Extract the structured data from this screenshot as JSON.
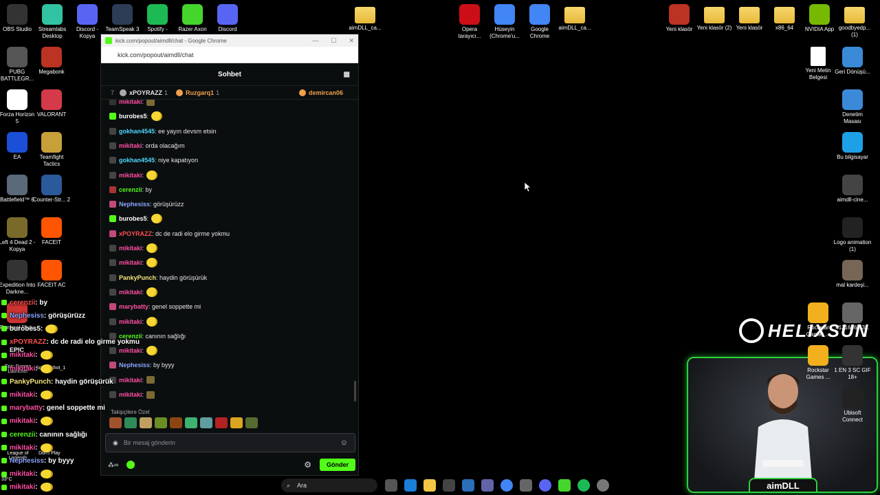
{
  "browser": {
    "title": "kick.com/popout/aimdll/chat - Google Chrome",
    "url": "kick.com/popout/aimdll/chat"
  },
  "chat": {
    "header": "Sohbet",
    "top_gifters": [
      {
        "rank": "7",
        "name": "xPOYRAZZ",
        "count": "1",
        "color": "#e3e3e3"
      },
      {
        "rank": "",
        "name": "Ruzgarq1",
        "count": "1",
        "color": "#f0a04b"
      },
      {
        "rank": "",
        "name": "demircan06",
        "count": "",
        "color": "#f0a04b"
      }
    ],
    "messages": [
      {
        "user": "mikitaki",
        "text": "",
        "color": "#ff4fa3",
        "emote": "box",
        "badge": "#333"
      },
      {
        "user": "burobes5",
        "text": "",
        "color": "#ffffff",
        "emote": "face",
        "badge": "#53fc18"
      },
      {
        "user": "gokhan4545",
        "text": ": ee yayın devsm etsin",
        "color": "#4fd8ff",
        "emote": "",
        "badge": "#444"
      },
      {
        "user": "mikitaki",
        "text": ": orda olacağım",
        "color": "#ff4fa3",
        "emote": "",
        "badge": "#444"
      },
      {
        "user": "gokhan4545",
        "text": ": niye kapatıyon",
        "color": "#4fd8ff",
        "emote": "",
        "badge": "#444"
      },
      {
        "user": "mikitaki",
        "text": "",
        "color": "#ff4fa3",
        "emote": "face",
        "badge": "#444"
      },
      {
        "user": "cerenzii",
        "text": ": by",
        "color": "#53fc18",
        "emote": "",
        "badge": "#a33"
      },
      {
        "user": "Nephesiss",
        "text": ": görüşürüzz",
        "color": "#8aa4ff",
        "emote": "",
        "badge": "#c24a7b"
      },
      {
        "user": "burobes5",
        "text": "",
        "color": "#ffffff",
        "emote": "face",
        "badge": "#53fc18"
      },
      {
        "user": "xPOYRAZZ",
        "text": ": dc de radi elo girme yokmu",
        "color": "#ff4f4f",
        "emote": "",
        "badge": "#c24a7b"
      },
      {
        "user": "mikitaki",
        "text": "",
        "color": "#ff4fa3",
        "emote": "face",
        "badge": "#444"
      },
      {
        "user": "mikitaki",
        "text": "",
        "color": "#ff4fa3",
        "emote": "face",
        "badge": "#444"
      },
      {
        "user": "PankyPunch",
        "text": ": haydin görüşürük",
        "color": "#f5e57a",
        "emote": "",
        "badge": "#444"
      },
      {
        "user": "mikitaki",
        "text": "",
        "color": "#ff4fa3",
        "emote": "face",
        "badge": "#444"
      },
      {
        "user": "marybatty",
        "text": ": genel soppette mi",
        "color": "#ff4fa3",
        "emote": "",
        "badge": "#c24a7b"
      },
      {
        "user": "mikitaki",
        "text": "",
        "color": "#ff4fa3",
        "emote": "face",
        "badge": "#444"
      },
      {
        "user": "cerenzii",
        "text": ": canının sağlığı",
        "color": "#53fc18",
        "emote": "",
        "badge": "#444"
      },
      {
        "user": "mikitaki",
        "text": "",
        "color": "#ff4fa3",
        "emote": "face",
        "badge": "#444"
      },
      {
        "user": "Nephesiss",
        "text": ": by byyy",
        "color": "#8aa4ff",
        "emote": "",
        "badge": "#c24a7b"
      },
      {
        "user": "mikitaki",
        "text": "",
        "color": "#ff4fa3",
        "emote": "box",
        "badge": "#444"
      },
      {
        "user": "mikitaki",
        "text": "",
        "color": "#ff4fa3",
        "emote": "box",
        "badge": "#444"
      }
    ],
    "followers_label": "Takipçilere Özel",
    "input_placeholder": "Bir mesaj gönderin",
    "send_label": "Gönder"
  },
  "overlay": [
    {
      "user": "cerenzii",
      "text": " : by",
      "color": "#ff4f4f",
      "emote": false
    },
    {
      "user": "Nephesiss",
      "text": " : görüşürüzz",
      "color": "#8aa4ff",
      "emote": false
    },
    {
      "user": "burobes5",
      "text": " :",
      "color": "#ffffff",
      "emote": true
    },
    {
      "user": "xPOYRAZZ",
      "text": " : dc de radi elo girme yokmu",
      "color": "#ff4f4f",
      "emote": false
    },
    {
      "user": "mikitaki",
      "text": " :",
      "color": "#ff4fa3",
      "emote": true
    },
    {
      "user": "mikitaki",
      "text": " :",
      "color": "#ff4fa3",
      "emote": true
    },
    {
      "user": "PankyPunch",
      "text": " : haydin görüşürük",
      "color": "#f5e57a",
      "emote": false
    },
    {
      "user": "mikitaki",
      "text": " :",
      "color": "#ff4fa3",
      "emote": true
    },
    {
      "user": "marybatty",
      "text": " : genel soppette mi",
      "color": "#ff4fa3",
      "emote": false
    },
    {
      "user": "mikitaki",
      "text": " :",
      "color": "#ff4fa3",
      "emote": true
    },
    {
      "user": "cerenzii",
      "text": " : canının sağlığı",
      "color": "#53fc18",
      "emote": false
    },
    {
      "user": "mikitaki",
      "text": " :",
      "color": "#ff4fa3",
      "emote": true
    },
    {
      "user": "Nephesiss",
      "text": " : by byyy",
      "color": "#8aa4ff",
      "emote": false
    },
    {
      "user": "mikitaki",
      "text": " :",
      "color": "#ff4fa3",
      "emote": true
    },
    {
      "user": "mikitaki",
      "text": " :",
      "color": "#ff4fa3",
      "emote": true
    }
  ],
  "desktop_left": [
    {
      "label": "OBS Studio",
      "color": "#333"
    },
    {
      "label": "Streamlabs Desktop",
      "color": "#31c3a2"
    },
    {
      "label": "Discord - Kopya",
      "color": "#5865f2"
    },
    {
      "label": "TeamSpeak 3",
      "color": "#2d3d56"
    },
    {
      "label": "Spotify -",
      "color": "#1db954"
    },
    {
      "label": "Razer Axon",
      "color": "#44d62c"
    },
    {
      "label": "Discord",
      "color": "#5865f2"
    }
  ],
  "desktop_col": [
    {
      "label": "PUBG BATTLEGR...",
      "color": "#555"
    },
    {
      "label": "Megabonk",
      "color": "#b32"
    },
    {
      "label": "Forza Horizon 5",
      "color": "#fff"
    },
    {
      "label": "VALORANT",
      "color": "#d43a4a"
    },
    {
      "label": "EA",
      "color": "#1c4fd8"
    },
    {
      "label": "Teamfight Tactics",
      "color": "#c7a03a"
    },
    {
      "label": "Battlefield™ 6",
      "color": "#5a6a7a"
    },
    {
      "label": "Counter-Str... 2",
      "color": "#2a5a9a"
    },
    {
      "label": "Left 4 Dead 2 - Kopya",
      "color": "#7a6a2a"
    },
    {
      "label": "FACEIT",
      "color": "#ff5500"
    },
    {
      "label": "Expedition Into Darkne...",
      "color": "#333"
    },
    {
      "label": "FACEIT AC",
      "color": "#ff5500"
    },
    {
      "label": "Pummel Party",
      "color": "#c33"
    }
  ],
  "desktop_top_mid": [
    {
      "label": "aimDLL_ca...",
      "type": "folder"
    },
    {
      "label": "Opera tarayıcı...",
      "color": "#cc0f16"
    },
    {
      "label": "Hüseyin (Chrome'u...",
      "color": "#4285f4"
    },
    {
      "label": "Google Chrome",
      "color": "#4285f4"
    },
    {
      "label": "aimDLL_ca...",
      "type": "folder"
    }
  ],
  "desktop_right_top": [
    {
      "label": "Yeni klasör",
      "color": "#b32"
    },
    {
      "label": "Yeni klasör (2)",
      "type": "folder"
    },
    {
      "label": "Yeni klasör",
      "type": "folder"
    },
    {
      "label": "x86_64",
      "type": "folder"
    },
    {
      "label": "NVIDIA App",
      "color": "#76b900"
    },
    {
      "label": "goodbyedp... (1)",
      "type": "folder"
    }
  ],
  "desktop_right_col": [
    {
      "label": "Yeni Metin Belgesi",
      "type": "doc"
    },
    {
      "label": "Geri Dönüşü...",
      "color": "#3a8ad8"
    },
    {
      "label": "Denetim Masası",
      "color": "#3a8ad8"
    },
    {
      "label": "Bu bilgisayar",
      "color": "#1ea0e6"
    },
    {
      "label": "aimdll-cine...",
      "color": "#444"
    },
    {
      "label": "Logo animation (1)",
      "color": "#222"
    },
    {
      "label": "mal kardeşi...",
      "color": "#765"
    },
    {
      "label": "41316661-3...",
      "color": "#666"
    },
    {
      "label": "1 EN 3 SC GIF 18+",
      "color": "#333"
    },
    {
      "label": "Ubisoft Connect",
      "color": "#222"
    }
  ],
  "desktop_rockstar": [
    {
      "label": "Rockstar Games ...",
      "color": "#f2b01e"
    },
    {
      "label": "Rockstar Games ...",
      "color": "#f2b01e"
    }
  ],
  "overlay_misc": {
    "epic": "EPIC",
    "epic_label": "Epic Games Launcher",
    "screenshot_label": "Screenshot_1",
    "league_label": "League of Legends",
    "dontplay_label": "Don't Play",
    "temp": "33°C"
  },
  "webcam": {
    "name": "aimDLL",
    "logo": "HELIXSUN"
  },
  "taskbar": {
    "search_placeholder": "Ara"
  }
}
